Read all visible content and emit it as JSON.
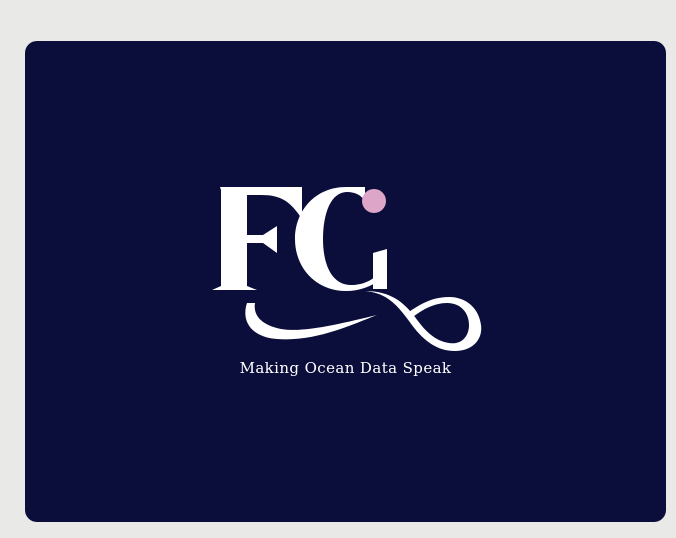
{
  "brand": {
    "logo_text": "FC",
    "tagline": "Making Ocean Data Speak",
    "icon": "fc-monogram-logo"
  },
  "colors": {
    "background": "#0b0d3a",
    "page": "#e9e9e7",
    "logo": "#ffffff",
    "accent_dot": "#dda5c8"
  }
}
